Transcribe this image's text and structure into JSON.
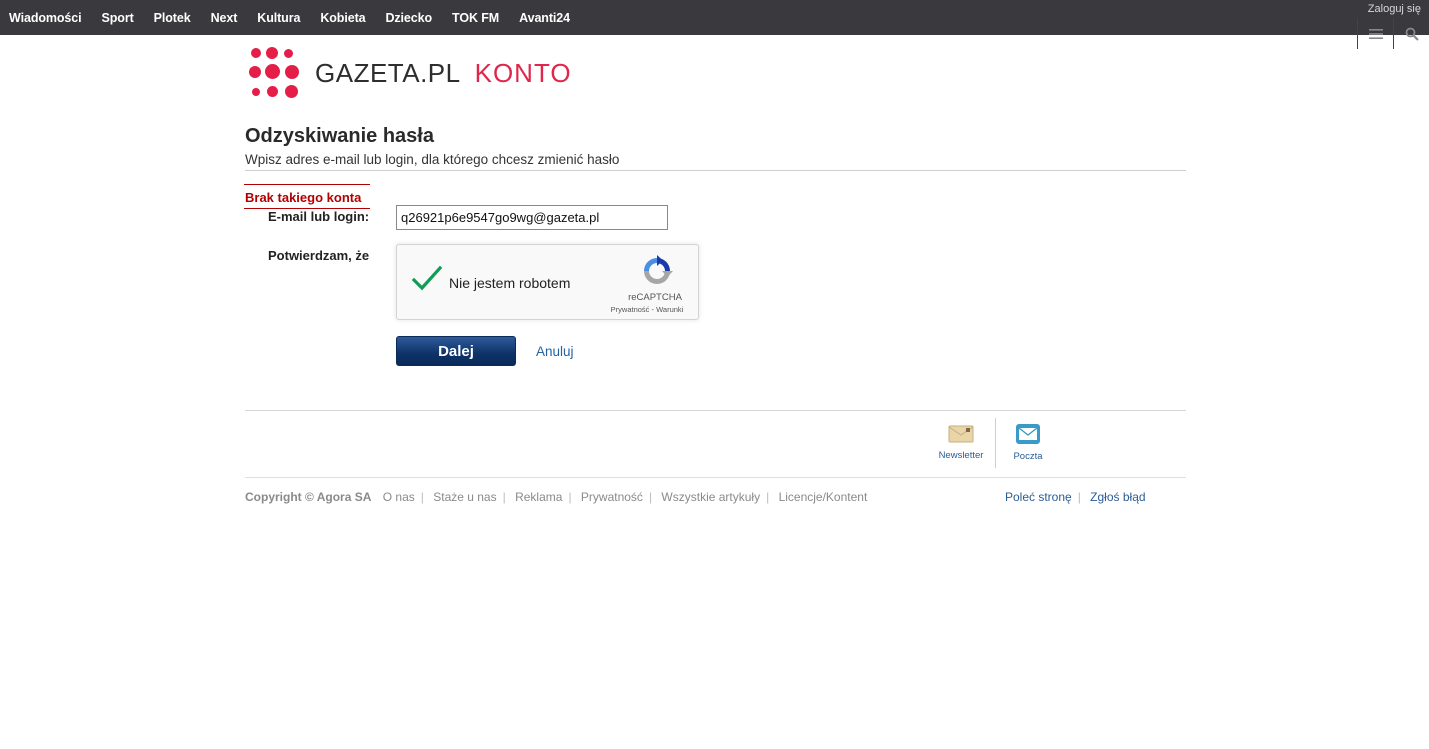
{
  "topnav": {
    "items": [
      "Wiadomości",
      "Sport",
      "Plotek",
      "Next",
      "Kultura",
      "Kobieta",
      "Dziecko",
      "TOK FM",
      "Avanti24"
    ],
    "login": "Zaloguj się",
    "menu_icon": "hamburger-icon",
    "search_icon": "search-icon"
  },
  "logo": {
    "brand": "GAZETA.PL",
    "section": "KONTO",
    "accent": "#e41e48"
  },
  "header": {
    "title": "Odzyskiwanie hasła",
    "subtitle": "Wpisz adres e-mail lub login, dla którego chcesz zmienić hasło"
  },
  "error": {
    "message": "Brak takiego konta",
    "color": "#b40000"
  },
  "form": {
    "email_label": "E-mail lub login:",
    "email_value": "q26921p6e9547go9wg@gazeta.pl",
    "confirm_label": "Potwierdzam, że",
    "submit_label": "Dalej",
    "cancel_label": "Anuluj"
  },
  "recaptcha": {
    "label": "Nie jestem robotem",
    "brand": "reCAPTCHA",
    "privacy": "Prywatność",
    "separator": " - ",
    "terms": "Warunki",
    "checked": true
  },
  "footer": {
    "icons": [
      {
        "label": "Newsletter",
        "icon": "newsletter-envelope-icon"
      },
      {
        "label": "Poczta",
        "icon": "mail-icon"
      }
    ],
    "copyright": "Copyright © Agora SA",
    "links": [
      "O nas",
      "Staże u nas",
      "Reklama",
      "Prywatność",
      "Wszystkie artykuły",
      "Licencje/Kontent"
    ],
    "right_links": [
      "Poleć stronę",
      "Zgłoś błąd"
    ]
  }
}
